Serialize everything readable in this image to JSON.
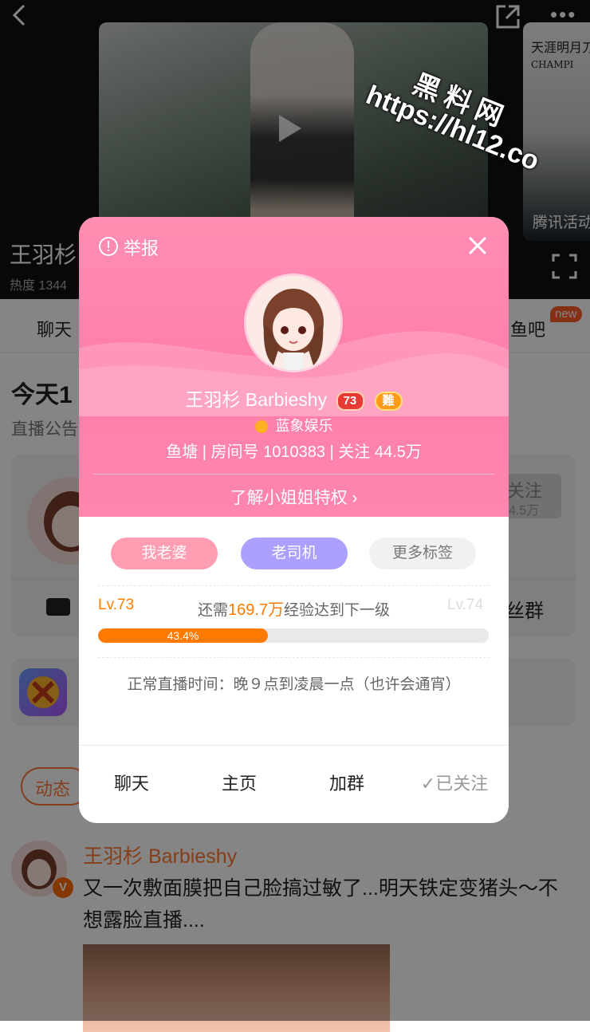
{
  "background": {
    "side_video_text": "天涯明月刀",
    "side_video_sub": "CHAMPI",
    "side_video_caption": "腾讯活动",
    "streamer_name": "王羽杉",
    "heat_label": "热度 1344",
    "tabs": {
      "chat": "聊天",
      "fishbar": "鱼吧",
      "new_badge": "new"
    },
    "today_title": "今天1",
    "notice_label": "直播公告",
    "follow_button": {
      "label": "关注",
      "count": "4.5万"
    },
    "fans_group": "丝群",
    "dynamic_tab": "动态",
    "post": {
      "user": "王羽杉 Barbieshy",
      "text": "又一次敷面膜把自己脸搞过敏了...明天铁定变猪头～不想露脸直播....",
      "verified_badge": "V"
    }
  },
  "watermark": {
    "line1": "黑料网",
    "line2": "https://hl12.co"
  },
  "modal": {
    "report_label": "举报",
    "name": "王羽杉 Barbieshy",
    "level_badge": "73",
    "difficulty_badge": "難",
    "organization": "蓝象娱乐",
    "stats": "鱼塘 | 房间号  1010383 | 关注  44.5万",
    "privilege_link": "了解小姐姐特权 ›",
    "tags": [
      "我老婆",
      "老司机",
      "更多标签"
    ],
    "level": {
      "current": "Lv.73",
      "next": "Lv.74",
      "prefix": "还需",
      "needed": "169.7万",
      "suffix": "经验达到下一级",
      "progress_label": "43.4%",
      "progress_value": 0.434
    },
    "live_time": "正常直播时间：晚９点到凌晨一点（也许会通宵）",
    "actions": {
      "chat": "聊天",
      "home": "主页",
      "join_group": "加群",
      "followed": "✓已关注"
    }
  },
  "colors": {
    "accent_orange": "#ff7a00",
    "modal_pink": "#ff86ae",
    "tag_pink": "#ff9eb2",
    "tag_purple": "#a9a0ff"
  }
}
